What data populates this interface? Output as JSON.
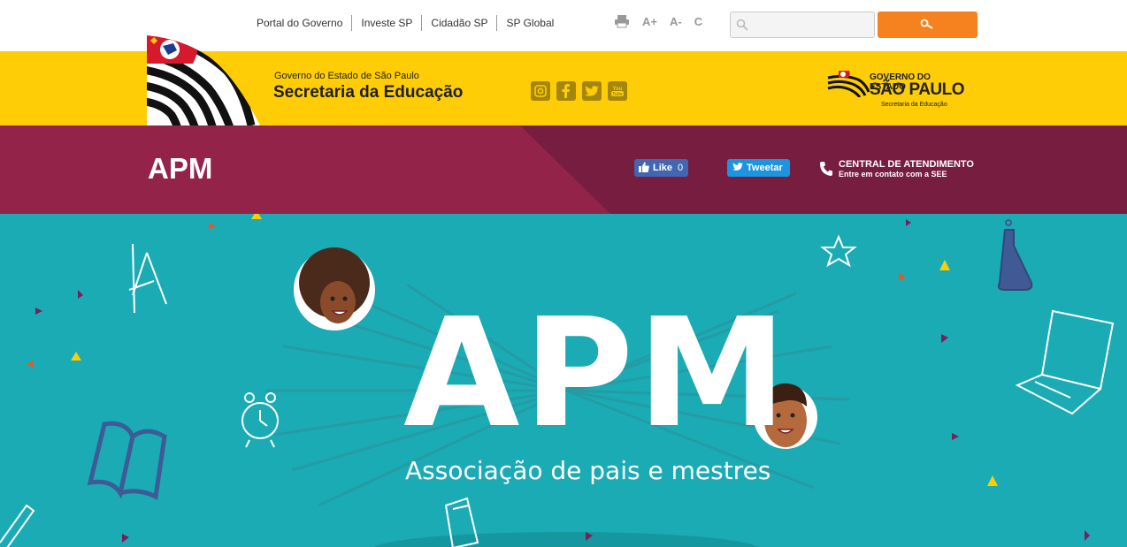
{
  "topnav": {
    "items": [
      {
        "label": "Portal do Governo"
      },
      {
        "label": "Investe SP"
      },
      {
        "label": "Cidadão SP"
      },
      {
        "label": "SP Global"
      }
    ]
  },
  "tools": {
    "print_icon": "printer-icon",
    "font_increase": "A+",
    "font_decrease": "A-",
    "contrast": "C"
  },
  "search": {
    "placeholder": "",
    "value": "",
    "button_icon": "key-icon"
  },
  "header": {
    "subtitle": "Governo do Estado de São Paulo",
    "title": "Secretaria da Educação",
    "social_icons": [
      "instagram-icon",
      "facebook-icon",
      "twitter-icon",
      "youtube-icon"
    ],
    "logo_line1": "GOVERNO DO ESTADO",
    "logo_line2": "SÃO PAULO",
    "logo_line3": "Secretaria da Educação"
  },
  "page": {
    "title": "APM"
  },
  "share": {
    "like_label": "Like",
    "like_count": "0",
    "tweet_label": "Tweetar"
  },
  "contact": {
    "title": "CENTRAL DE ATENDIMENTO",
    "subtitle": "Entre em contato com a SEE"
  },
  "banner": {
    "title": "APM",
    "subtitle": "Associação de pais e mestres"
  },
  "colors": {
    "yellow": "#fecd06",
    "purple": "#932349",
    "purple_dark": "#761d40",
    "teal": "#1aabb4",
    "orange": "#f5821f"
  }
}
